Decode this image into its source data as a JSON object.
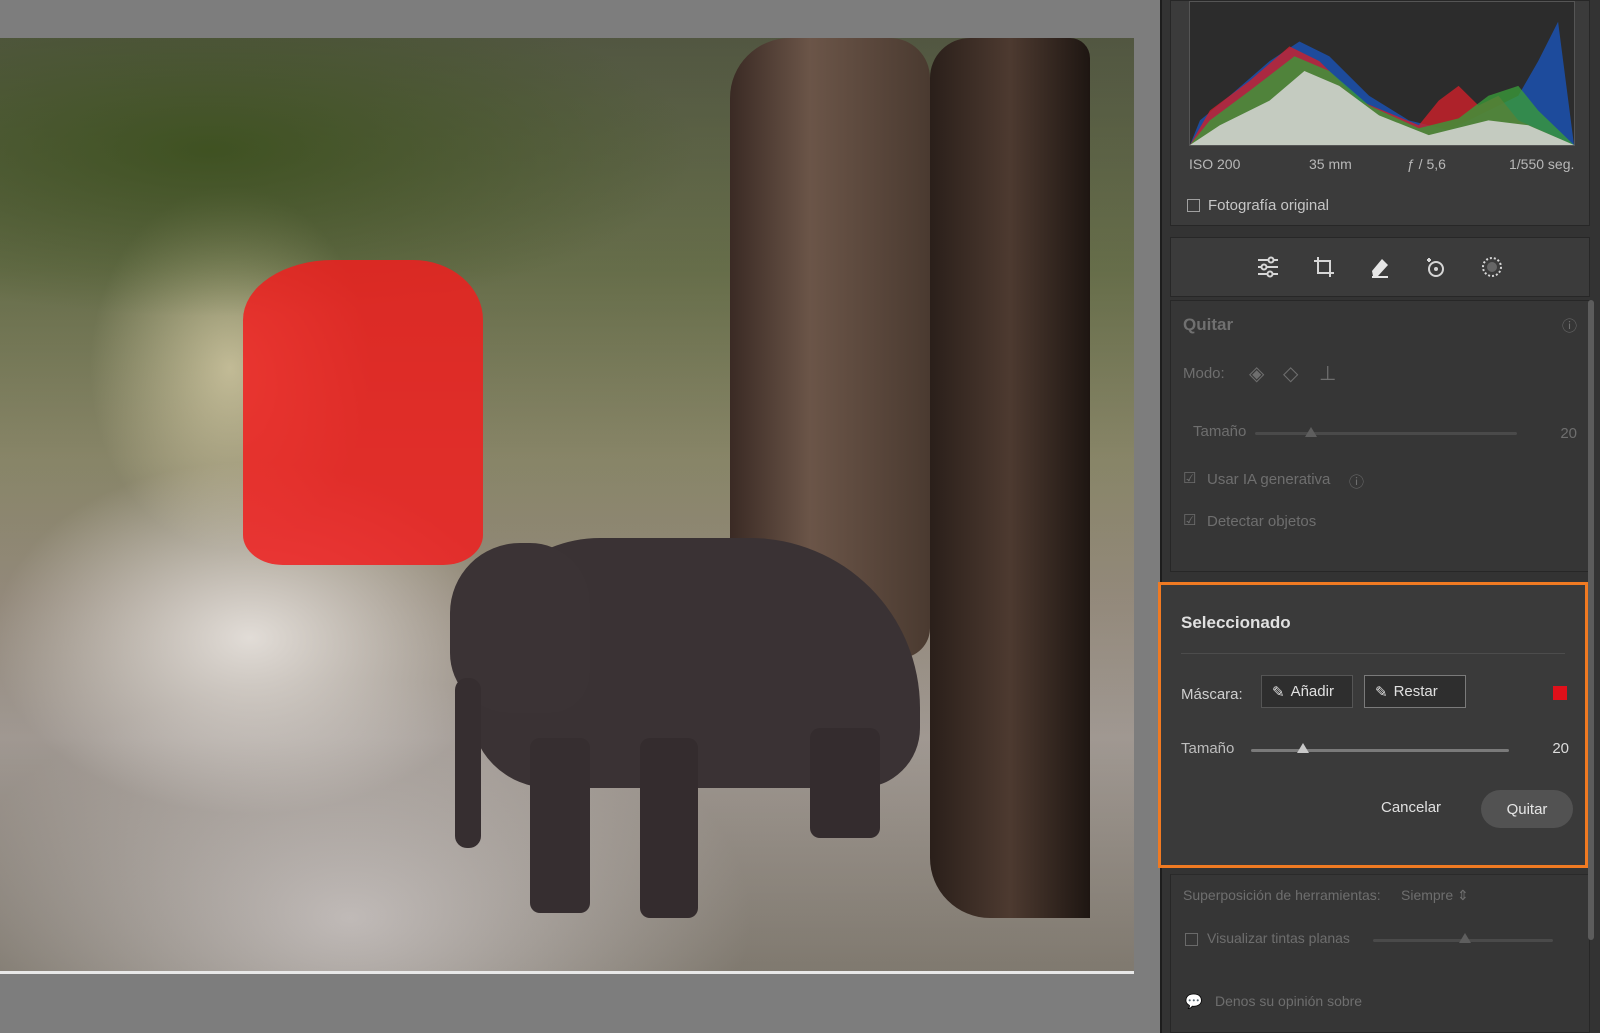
{
  "histogram": {
    "iso": "ISO 200",
    "focal": "35 mm",
    "aperture": "ƒ / 5,6",
    "shutter": "1/550 seg.",
    "original_label": "Fotografía original"
  },
  "tools": [
    "sliders-icon",
    "crop-icon",
    "eraser-icon",
    "heal-icon",
    "masking-icon"
  ],
  "remove": {
    "title": "Quitar",
    "mode_label": "Modo:",
    "size_label": "Tamaño",
    "size_value": "20",
    "generative_label": "Usar IA generativa",
    "detect_label": "Detectar objetos"
  },
  "selected": {
    "title": "Seleccionado",
    "mask_label": "Máscara:",
    "add_label": "Añadir",
    "subtract_label": "Restar",
    "size_label": "Tamaño",
    "size_value": "20",
    "size_level": 0.2,
    "cancel_label": "Cancelar",
    "apply_label": "Quitar",
    "mask_color": "#e0101a"
  },
  "bottom": {
    "overlay_label": "Superposición de herramientas:",
    "overlay_value": "Siempre ⇕",
    "flat_label": "Visualizar tintas planas",
    "feedback_label": "Denos su opinión sobre"
  }
}
